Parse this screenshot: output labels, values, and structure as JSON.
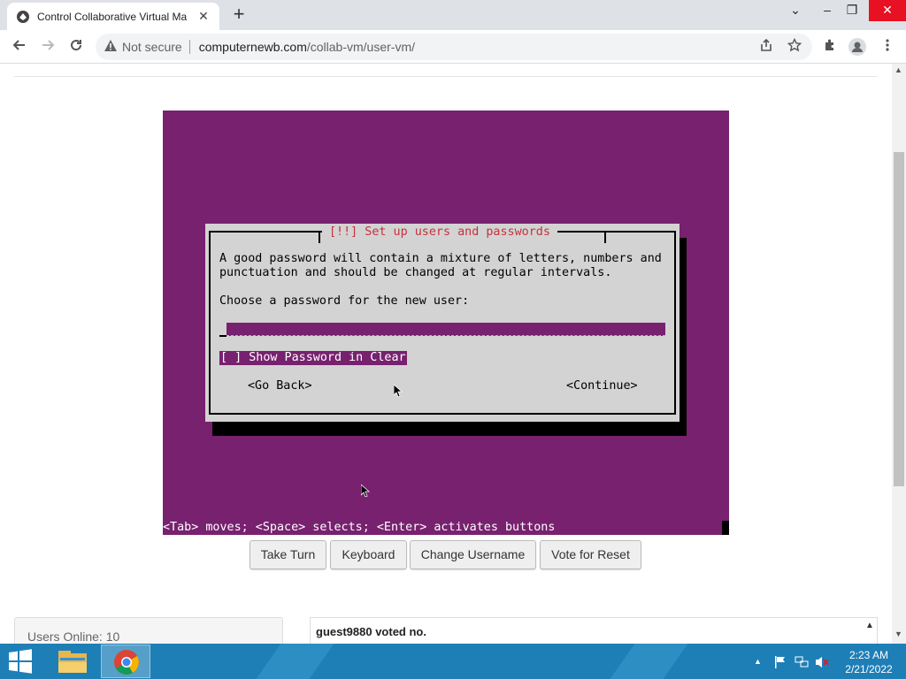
{
  "browser": {
    "tab_title": "Control Collaborative Virtual Ma",
    "tab_close": "✕",
    "new_tab": "+",
    "not_secure": "Not secure",
    "url_domain": "computernewb.com",
    "url_path": "/collab-vm/user-vm/",
    "window_controls": [
      "⌄",
      "–",
      "❐",
      "✕"
    ]
  },
  "vm": {
    "dialog_title": "[!!] Set up users and passwords",
    "text_line1": "A good password will contain a mixture of letters, numbers and",
    "text_line2": "punctuation and should be changed at regular intervals.",
    "prompt": "Choose a password for the new user:",
    "show_password": "[ ] Show Password in Clear",
    "go_back": "<Go Back>",
    "continue": "<Continue>",
    "hint": "<Tab> moves; <Space> selects; <Enter> activates buttons",
    "colors": {
      "background": "#77216f",
      "dialog": "#d3d3d3",
      "title": "#c7313a"
    }
  },
  "controls": {
    "take_turn": "Take Turn",
    "keyboard": "Keyboard",
    "change_username": "Change Username",
    "vote_reset": "Vote for Reset"
  },
  "users_online": "Users Online: 10",
  "chat_message": "guest9880 voted no.",
  "taskbar": {
    "time": "2:23 AM",
    "date": "2/21/2022",
    "tray_expand": "▲"
  }
}
